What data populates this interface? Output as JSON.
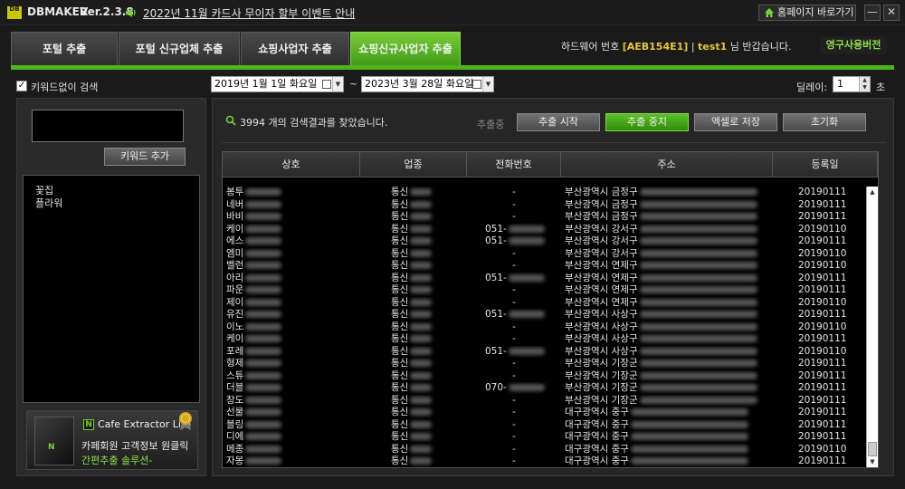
{
  "app": {
    "logo": "DB",
    "name": "DBMAKER",
    "version": "Ver.2.3.8",
    "notice": "2022년 11월 카드사 무이자 할부 이벤트 안내",
    "home_button": "홈페이지 바로가기",
    "minimize": "—",
    "close": "✕"
  },
  "tabs": [
    {
      "label": "포털 추출",
      "active": false
    },
    {
      "label": "포털 신규업체 추출",
      "active": false
    },
    {
      "label": "쇼핑사업자 추출",
      "active": false
    },
    {
      "label": "쇼핑신규사업자 추출",
      "active": true
    }
  ],
  "header": {
    "hw_prefix": "하드웨어 번호",
    "hw_code": "[AEB154E1]",
    "separator": "|",
    "user": "test1",
    "greeting": "님 반갑습니다.",
    "license": "영구사용버전"
  },
  "options": {
    "no_keyword_label": "키워드없이 검색",
    "no_keyword_checked": true,
    "date_from": "2019년  1월  1일 화요일",
    "date_to": "2023년  3월 28일 화요일",
    "tilde": "~",
    "delay_label": "딜레이:",
    "delay_value": "1",
    "delay_unit": "초"
  },
  "keywords": {
    "input_value": "",
    "add_button": "키워드 추가",
    "items": [
      "꽃집",
      "플라워"
    ]
  },
  "ad": {
    "product_icon": "N",
    "product_name": "Cafe Extractor Lite",
    "line1": "카페회원 고객정보 원클릭",
    "line2": "간편추출 솔루션-"
  },
  "results": {
    "summary": "3994 개의 검색결과를 찾았습니다.",
    "status": "추출중",
    "buttons": {
      "start": "추출 시작",
      "stop": "추출 중지",
      "excel": "엑셀로 저장",
      "reset": "초기화"
    },
    "columns": [
      "상호",
      "업종",
      "전화번호",
      "주소",
      "등록일"
    ],
    "rows": [
      {
        "name": "봉투",
        "type": "통신",
        "phone": "-",
        "addr": "부산광역시 금정구",
        "date": "20190111"
      },
      {
        "name": "네버",
        "type": "통신",
        "phone": "-",
        "addr": "부산광역시 금정구",
        "date": "20190111"
      },
      {
        "name": "바비",
        "type": "통신",
        "phone": "-",
        "addr": "부산광역시 금정구",
        "date": "20190111"
      },
      {
        "name": "케이",
        "type": "통신",
        "phone": "051-",
        "addr": "부산광역시 강서구",
        "date": "20190110"
      },
      {
        "name": "에스",
        "type": "통신",
        "phone": "051-",
        "addr": "부산광역시 강서구",
        "date": "20190111"
      },
      {
        "name": "엠미",
        "type": "통신",
        "phone": "-",
        "addr": "부산광역시 강서구",
        "date": "20190110"
      },
      {
        "name": "벨런",
        "type": "통신",
        "phone": "-",
        "addr": "부산광역시 연제구",
        "date": "20190110"
      },
      {
        "name": "아리",
        "type": "통신",
        "phone": "051-",
        "addr": "부산광역시 연제구",
        "date": "20190111"
      },
      {
        "name": "파운",
        "type": "통신",
        "phone": "-",
        "addr": "부산광역시 연제구",
        "date": "20190111"
      },
      {
        "name": "제이",
        "type": "통신",
        "phone": "-",
        "addr": "부산광역시 연제구",
        "date": "20190110"
      },
      {
        "name": "유진",
        "type": "통신",
        "phone": "051-",
        "addr": "부산광역시 사상구",
        "date": "20190111"
      },
      {
        "name": "이노",
        "type": "통신",
        "phone": "-",
        "addr": "부산광역시 사상구",
        "date": "20190110"
      },
      {
        "name": "케이",
        "type": "통신",
        "phone": "-",
        "addr": "부산광역시 사상구",
        "date": "20190111"
      },
      {
        "name": "포레",
        "type": "통신",
        "phone": "051-",
        "addr": "부산광역시 사상구",
        "date": "20190110"
      },
      {
        "name": "형제",
        "type": "통신",
        "phone": "-",
        "addr": "부산광역시 기장군",
        "date": "20190111"
      },
      {
        "name": "스튜",
        "type": "통신",
        "phone": "-",
        "addr": "부산광역시 기장군",
        "date": "20190111"
      },
      {
        "name": "더블",
        "type": "통신",
        "phone": "070-",
        "addr": "부산광역시 기장군",
        "date": "20190111"
      },
      {
        "name": "창도",
        "type": "통신",
        "phone": "-",
        "addr": "부산광역시 기장군",
        "date": "20190111"
      },
      {
        "name": "선물",
        "type": "통신",
        "phone": "-",
        "addr": "대구광역시 중구",
        "date": "20190111"
      },
      {
        "name": "블링",
        "type": "통신",
        "phone": "-",
        "addr": "대구광역시 중구",
        "date": "20190111"
      },
      {
        "name": "디에",
        "type": "통신",
        "phone": "-",
        "addr": "대구광역시 중구",
        "date": "20190111"
      },
      {
        "name": "메종",
        "type": "통신",
        "phone": "-",
        "addr": "대구광역시 중구",
        "date": "20190110"
      },
      {
        "name": "자몽",
        "type": "통신",
        "phone": "-",
        "addr": "대구광역시 중구",
        "date": "20190111"
      }
    ]
  }
}
